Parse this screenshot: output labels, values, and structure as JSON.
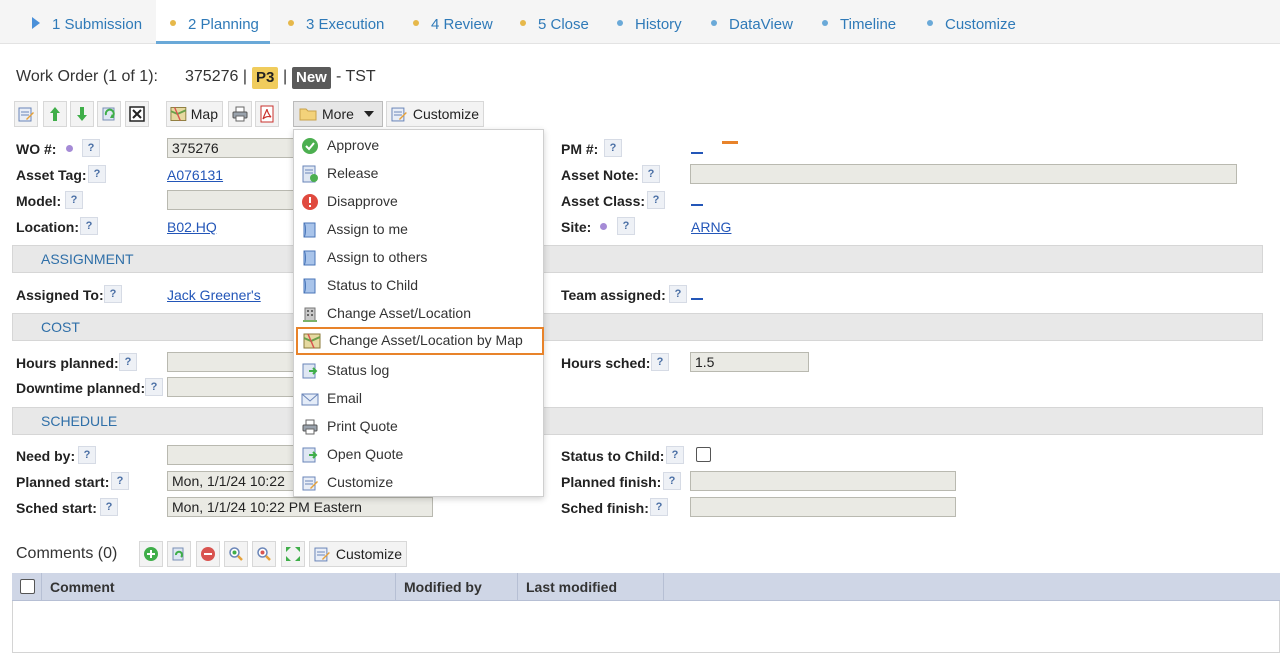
{
  "tabs": [
    {
      "label": "1 Submission",
      "marker": "triangle",
      "color": "#4a90d9"
    },
    {
      "label": "2 Planning",
      "marker": "dot",
      "color": "#e6b84a",
      "active": true
    },
    {
      "label": "3 Execution",
      "marker": "dot",
      "color": "#e6b84a"
    },
    {
      "label": "4 Review",
      "marker": "dot",
      "color": "#e6b84a"
    },
    {
      "label": "5 Close",
      "marker": "dot",
      "color": "#e6b84a"
    },
    {
      "label": "History",
      "marker": "dot",
      "color": "#6aa9d8"
    },
    {
      "label": "DataView",
      "marker": "dot",
      "color": "#6aa9d8"
    },
    {
      "label": "Timeline",
      "marker": "dot",
      "color": "#6aa9d8"
    },
    {
      "label": "Customize",
      "marker": "dot",
      "color": "#6aa9d8"
    }
  ],
  "header": {
    "title": "Work Order (1 of 1):",
    "number": "375276 |",
    "priority": "P3",
    "sep": "|",
    "status": "New",
    "suffix": "- TST"
  },
  "toolbar": {
    "map_label": "Map",
    "more_label": "More",
    "customize_label": "Customize"
  },
  "menu": {
    "items": [
      {
        "label": "Approve",
        "icon": "check-circle-icon"
      },
      {
        "label": "Release",
        "icon": "release-icon"
      },
      {
        "label": "Disapprove",
        "icon": "alert-circle-icon"
      },
      {
        "label": "Assign to me",
        "icon": "clipboard-icon"
      },
      {
        "label": "Assign to others",
        "icon": "clipboard-icon"
      },
      {
        "label": "Status to Child",
        "icon": "clipboard-icon"
      },
      {
        "label": "Change Asset/Location",
        "icon": "building-icon"
      },
      {
        "label": "Change Asset/Location by Map",
        "icon": "map-icon",
        "highlighted": true
      },
      {
        "label": "Status log",
        "icon": "export-icon"
      },
      {
        "label": "Email",
        "icon": "envelope-icon"
      },
      {
        "label": "Print Quote",
        "icon": "printer-icon"
      },
      {
        "label": "Open Quote",
        "icon": "export-icon"
      },
      {
        "label": "Customize",
        "icon": "customize-icon"
      }
    ]
  },
  "form": {
    "wo_label": "WO #:",
    "wo_value": "375276",
    "asset_tag_label": "Asset Tag:",
    "asset_tag_value": "A076131",
    "model_label": "Model:",
    "location_label": "Location:",
    "location_value": "B02.HQ",
    "pm_label": "PM #:",
    "asset_note_label": "Asset Note:",
    "asset_class_label": "Asset Class:",
    "site_label": "Site:",
    "site_value": "ARNG",
    "assignment_section": "ASSIGNMENT",
    "assigned_to_label": "Assigned To:",
    "assigned_to_value": "Jack Greener's",
    "team_assigned_label": "Team assigned:",
    "cost_section": "COST",
    "hours_planned_label": "Hours planned:",
    "downtime_planned_label": "Downtime planned:",
    "hours_sched_label": "Hours sched:",
    "hours_sched_value": "1.5",
    "schedule_section": "SCHEDULE",
    "need_by_label": "Need by:",
    "planned_start_label": "Planned start:",
    "planned_start_value": "Mon, 1/1/24 10:22",
    "sched_start_label": "Sched start:",
    "sched_start_value": "Mon, 1/1/24 10:22 PM Eastern",
    "status_to_child_label": "Status to Child:",
    "planned_finish_label": "Planned finish:",
    "sched_finish_label": "Sched finish:",
    "help_glyph": "?"
  },
  "comments": {
    "title": "Comments (0)",
    "customize_label": "Customize",
    "columns": [
      "Comment",
      "Modified by",
      "Last modified"
    ]
  },
  "colors": {
    "accent": "#2f7ab8",
    "highlight_border": "#e8832a",
    "priority_badge": "#f0cc5c",
    "status_badge": "#5a5a5a"
  }
}
